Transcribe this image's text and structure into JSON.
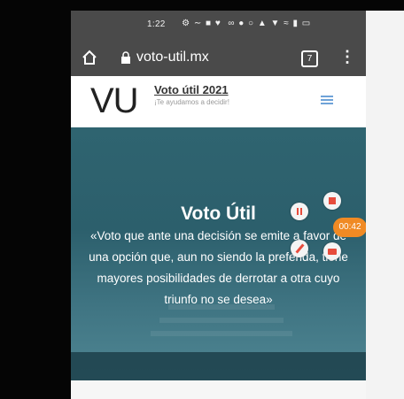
{
  "status_bar": {
    "time": "1:22",
    "icons": [
      "notification-icon",
      "wifi-icon",
      "signal-icon",
      "battery-icon"
    ]
  },
  "browser": {
    "url": "voto-util.mx",
    "tab_count": "7"
  },
  "site": {
    "logo": "VU",
    "title": "Voto útil 2021",
    "tagline": "¡Te ayudamos a decidir!"
  },
  "hero": {
    "title": "Voto Útil",
    "quote": "«Voto que ante una decisión se emite a favor de una opción que, aun no siendo la preferida, tiene mayores posibilidades de derrotar a otra cuyo triunfo no se desea»"
  },
  "recorder": {
    "timer": "00:42"
  },
  "colors": {
    "hero_bg": "#2f6470",
    "browser_bar": "#4a4a4a",
    "accent": "#6fa3d8",
    "recorder": "#f08a24"
  }
}
